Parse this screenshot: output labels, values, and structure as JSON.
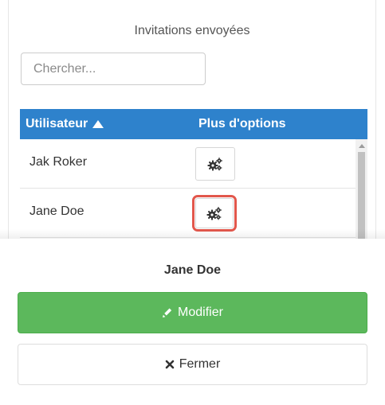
{
  "panel": {
    "title": "Invitations envoyées",
    "search": {
      "placeholder": "Chercher...",
      "value": ""
    }
  },
  "table": {
    "columns": {
      "user": "Utilisateur",
      "options": "Plus d'options"
    },
    "sort": {
      "column": "user",
      "direction": "ascending",
      "icon": "caret-up-icon"
    },
    "rows": [
      {
        "name": "Jak Roker",
        "action_icon": "gears-icon"
      },
      {
        "name": "Jane Doe",
        "action_icon": "gears-icon",
        "highlighted": true
      }
    ]
  },
  "action_sheet": {
    "title": "Jane Doe",
    "modify_label": "Modifier",
    "modify_icon": "pencil-icon",
    "close_label": "Fermer",
    "close_icon": "times-icon"
  },
  "colors": {
    "header_blue": "#2e82cc",
    "success_green": "#5cb85c",
    "highlight_red": "#e2574c"
  }
}
